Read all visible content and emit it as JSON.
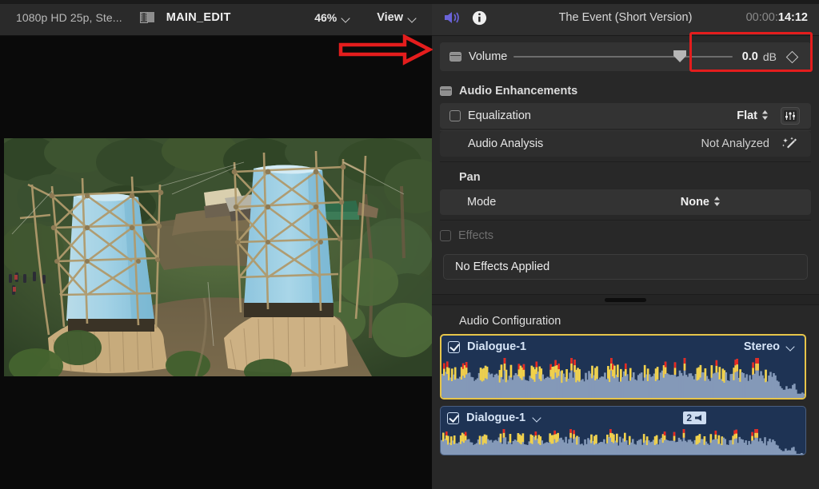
{
  "viewer": {
    "format": "1080p HD 25p, Ste...",
    "project_icon": "filmstrip-icon",
    "title": "MAIN_EDIT",
    "zoom": "46%",
    "view_label": "View",
    "preview_alt": "aerial-drone-view-two-conical-bamboo-structures"
  },
  "inspector": {
    "tabs": [
      {
        "name": "audio-tab",
        "icon": "speaker-icon",
        "active": true
      },
      {
        "name": "info-tab",
        "icon": "info-circle-icon",
        "active": false
      }
    ],
    "title": "The Event (Short Version)",
    "timecode_dim": "00:00:",
    "timecode_lit": "14:12",
    "volume": {
      "label": "Volume",
      "value": "0.0",
      "unit": "dB",
      "slider_percent": 76,
      "keyframe_icon": "diamond-keyframe-icon"
    },
    "audio_enhancements": {
      "label": "Audio Enhancements",
      "equalization": {
        "label": "Equalization",
        "value": "Flat",
        "icon": "equalizer-icon"
      },
      "audio_analysis": {
        "label": "Audio Analysis",
        "value": "Not Analyzed",
        "icon": "magic-wand-icon"
      }
    },
    "pan": {
      "label": "Pan",
      "mode_label": "Mode",
      "mode_value": "None"
    },
    "effects": {
      "label": "Effects",
      "empty_text": "No Effects Applied"
    },
    "audio_configuration": {
      "label": "Audio Configuration",
      "components": [
        {
          "name": "Dialogue-1",
          "enabled": true,
          "selected": true,
          "channel_value": "Stereo",
          "badge": null
        },
        {
          "name": "Dialogue-1",
          "enabled": true,
          "selected": false,
          "channel_value": null,
          "badge": "2"
        }
      ]
    }
  },
  "annotations": {
    "arrow": {
      "name": "red-arrow-pointing-right",
      "color": "#e41d1d"
    },
    "highlight_box": {
      "name": "red-highlight-volume-value",
      "color": "#e41d1d"
    }
  },
  "colors": {
    "accent_red": "#e41d1d",
    "selection_yellow": "#e6c54a",
    "waveform_body": "#8499b8",
    "waveform_peak": "#e8281e",
    "waveform_bg": "#1e3354",
    "tab_active": "#6a63d8"
  }
}
